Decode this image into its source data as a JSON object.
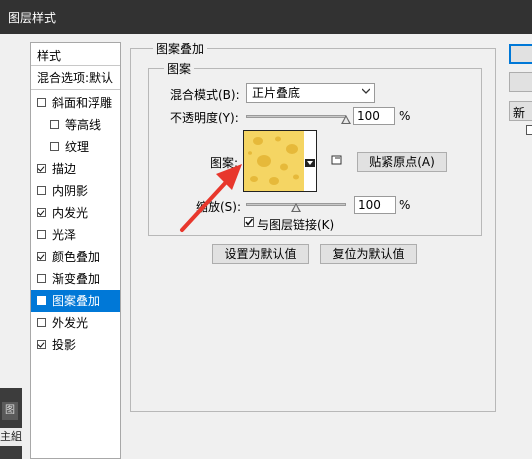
{
  "window": {
    "title": "图层样式"
  },
  "sidebar": {
    "items": [
      {
        "label": "样式",
        "checkbox": false,
        "checked": false,
        "indent": false,
        "selected": false
      },
      {
        "label": "混合选项:默认",
        "checkbox": false,
        "checked": false,
        "indent": false,
        "selected": false
      },
      {
        "label": "斜面和浮雕",
        "checkbox": true,
        "checked": false,
        "indent": false,
        "selected": false
      },
      {
        "label": "等高线",
        "checkbox": true,
        "checked": false,
        "indent": true,
        "selected": false
      },
      {
        "label": "纹理",
        "checkbox": true,
        "checked": false,
        "indent": true,
        "selected": false
      },
      {
        "label": "描边",
        "checkbox": true,
        "checked": true,
        "indent": false,
        "selected": false
      },
      {
        "label": "内阴影",
        "checkbox": true,
        "checked": false,
        "indent": false,
        "selected": false
      },
      {
        "label": "内发光",
        "checkbox": true,
        "checked": true,
        "indent": false,
        "selected": false
      },
      {
        "label": "光泽",
        "checkbox": true,
        "checked": false,
        "indent": false,
        "selected": false
      },
      {
        "label": "颜色叠加",
        "checkbox": true,
        "checked": true,
        "indent": false,
        "selected": false
      },
      {
        "label": "渐变叠加",
        "checkbox": true,
        "checked": false,
        "indent": false,
        "selected": false
      },
      {
        "label": "图案叠加",
        "checkbox": true,
        "checked": true,
        "indent": false,
        "selected": true
      },
      {
        "label": "外发光",
        "checkbox": true,
        "checked": false,
        "indent": false,
        "selected": false
      },
      {
        "label": "投影",
        "checkbox": true,
        "checked": true,
        "indent": false,
        "selected": false
      }
    ]
  },
  "panel": {
    "group_title": "图案叠加",
    "subgroup_title": "图案",
    "blend_mode_label": "混合模式(B):",
    "blend_mode_value": "正片叠底",
    "opacity_label": "不透明度(Y):",
    "opacity_value": "100",
    "opacity_fraction": 1.0,
    "percent": "%",
    "pattern_label": "图案:",
    "snap_button": "贴紧原点(A)",
    "scale_label": "缩放(S):",
    "scale_value": "100",
    "link_label": "与图层链接(K)",
    "link_checked": true,
    "set_default_button": "设置为默认值",
    "reset_default_button": "复位为默认值"
  },
  "right": {
    "new_label": "新"
  },
  "taskbar": {
    "tab1": "图",
    "tab2": "主組"
  },
  "colors": {
    "accent": "#0078d7",
    "pattern_yellow": "#f5d563",
    "arrow_red": "#e8372c",
    "titlebar": "#323232"
  }
}
